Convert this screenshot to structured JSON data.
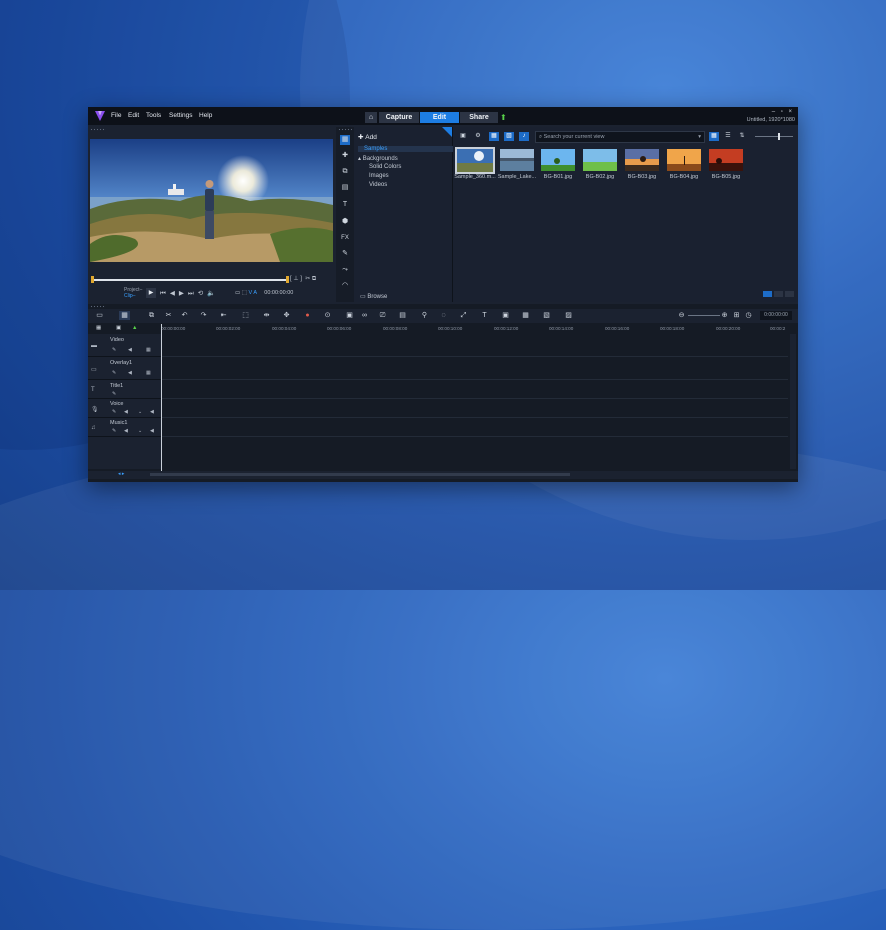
{
  "colors": {
    "accent": "#1d7de3",
    "upload": "#57d04a",
    "panel": "#1b2230"
  },
  "menu": [
    "File",
    "Edit",
    "Tools",
    "Settings",
    "Help"
  ],
  "tabs": {
    "capture": "Capture",
    "edit": "Edit",
    "share": "Share"
  },
  "window": {
    "project_info": "Untitled, 1920*1080",
    "controls": "– ▫ ×"
  },
  "player": {
    "project_label": "Project–",
    "clip_label": "Clip–",
    "timecode": "00:00:00:00"
  },
  "library": {
    "add_label": "Add",
    "tree": [
      {
        "label": "Samples",
        "level": 1,
        "selected": true
      },
      {
        "label": "Backgrounds",
        "level": 1,
        "selected": false
      },
      {
        "label": "Solid Colors",
        "level": 2,
        "selected": false
      },
      {
        "label": "Images",
        "level": 2,
        "selected": false
      },
      {
        "label": "Videos",
        "level": 2,
        "selected": false
      }
    ],
    "browse_label": "Browse",
    "search_placeholder": "Search your current view",
    "thumbnails": [
      {
        "name": "Sample_360.m...",
        "color": "#5f86b7"
      },
      {
        "name": "Sample_Lake...",
        "color": "#7ea2c4"
      },
      {
        "name": "BG-B01.jpg",
        "color": "#5ea6e0"
      },
      {
        "name": "BG-B02.jpg",
        "color": "#6fbf4a"
      },
      {
        "name": "BG-B03.jpg",
        "color": "#e79b4c"
      },
      {
        "name": "BG-B04.jpg",
        "color": "#f0a54a"
      },
      {
        "name": "BG-B05.jpg",
        "color": "#c43d22"
      }
    ]
  },
  "timeline": {
    "timecode": "0:00:00:00",
    "ruler": [
      "00:00:00:00",
      "00:00:02:00",
      "00:00:04:00",
      "00:00:06:00",
      "00:00:08:00",
      "00:00:10:00",
      "00:00:12:00",
      "00:00:14:00",
      "00:00:16:00",
      "00:00:18:00",
      "00:00:20:00",
      "00:00:2"
    ],
    "tracks": [
      {
        "name": "Video",
        "icon": "video-track-icon"
      },
      {
        "name": "Overlay1",
        "icon": "overlay-track-icon"
      },
      {
        "name": "Title1",
        "icon": "title-track-icon"
      },
      {
        "name": "Voice",
        "icon": "voice-track-icon"
      },
      {
        "name": "Music1",
        "icon": "music-track-icon"
      }
    ]
  }
}
